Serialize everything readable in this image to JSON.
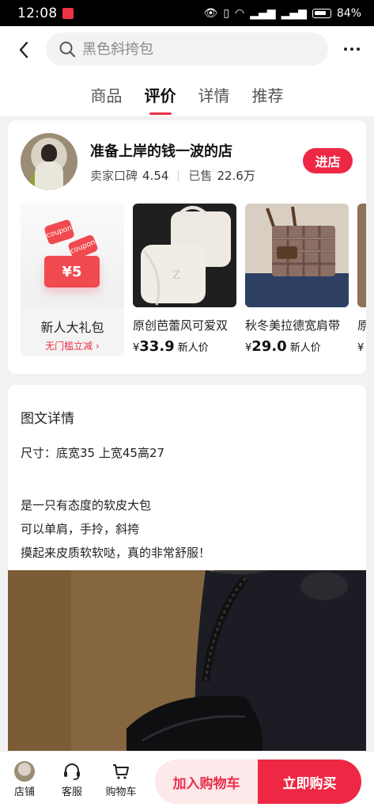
{
  "status_bar": {
    "time": "12:08",
    "battery": "84%"
  },
  "header": {
    "search_placeholder": "黑色斜挎包",
    "tabs": [
      {
        "label": "商品",
        "active": false
      },
      {
        "label": "评价",
        "active": true
      },
      {
        "label": "详情",
        "active": false
      },
      {
        "label": "推荐",
        "active": false
      }
    ]
  },
  "store": {
    "name": "准备上岸的钱一波的店",
    "rating_label": "卖家口碑",
    "rating": "4.54",
    "sold_label": "已售",
    "sold": "22.6万",
    "enter_label": "进店"
  },
  "gift": {
    "title": "新人大礼包",
    "subtitle": "无门槛立减",
    "coupon_value": "¥5",
    "coupon_text": "coupon"
  },
  "products": [
    {
      "title": "原创芭蕾风可爱双",
      "currency": "¥",
      "price": "33.9",
      "tag": "新人价"
    },
    {
      "title": "秋冬美拉德宽肩带",
      "currency": "¥",
      "price": "29.0",
      "tag": "新人价"
    },
    {
      "title": "原",
      "currency": "¥",
      "price": "",
      "tag": ""
    }
  ],
  "detail": {
    "title": "图文详情",
    "size_line": "尺寸：底宽35 上宽45高27",
    "desc_lines": [
      "是一只有态度的软皮大包",
      "可以单肩，手拎，斜挎",
      "摸起来皮质软软哒，真的非常舒服！"
    ]
  },
  "bottom_bar": {
    "store_label": "店铺",
    "service_label": "客服",
    "cart_label": "购物车",
    "add_cart_label": "加入购物车",
    "buy_label": "立即购买"
  },
  "colors": {
    "accent": "#ee2844",
    "accent_light": "#fde8ea"
  }
}
